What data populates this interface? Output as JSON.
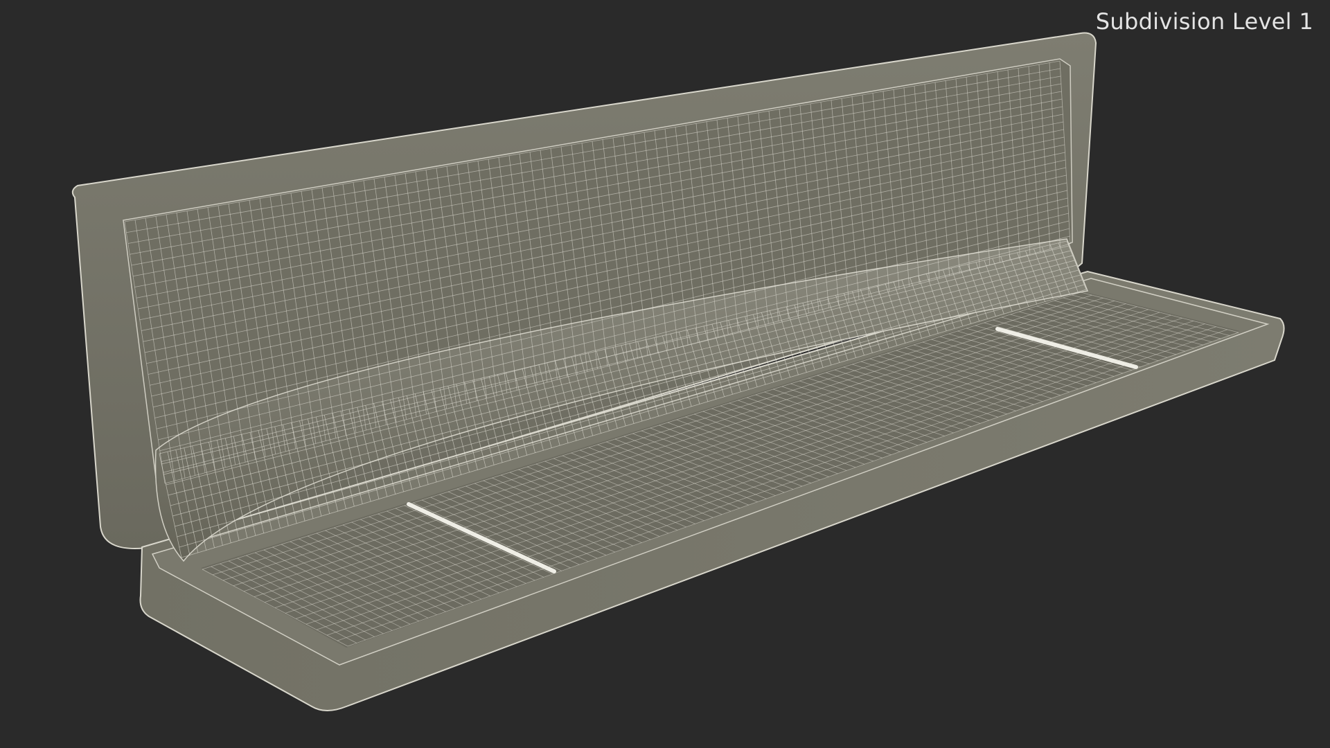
{
  "viewport": {
    "label": "Subdivision Level 1",
    "background_color": "#2a2a2a",
    "model_fill_color": "#767568",
    "wire_color": "#e4e2d8"
  },
  "model": {
    "subject": "open long jewelry case, wireframe render",
    "parts": [
      "lid-frame",
      "lid-inner-panel",
      "pillow-roll",
      "base-tray",
      "base-rim",
      "slot-left",
      "slot-right"
    ]
  }
}
